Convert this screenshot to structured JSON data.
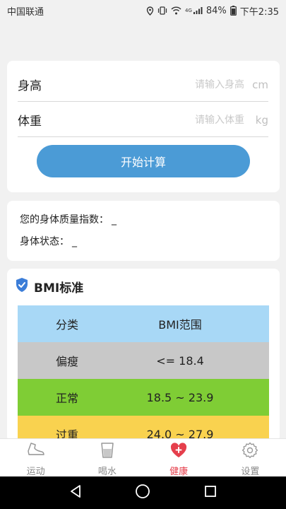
{
  "status_bar": {
    "carrier": "中国联通",
    "network": "4G",
    "battery": "84%",
    "time": "下午2:35"
  },
  "form": {
    "height_label": "身高",
    "height_placeholder": "请输入身高",
    "height_unit": "cm",
    "weight_label": "体重",
    "weight_placeholder": "请输入体重",
    "weight_unit": "kg",
    "calc_button": "开始计算"
  },
  "result": {
    "bmi_label": "您的身体质量指数：",
    "bmi_value": "_",
    "state_label": "身体状态：",
    "state_value": "_"
  },
  "bmi_standard": {
    "title": "BMI标准",
    "header": {
      "category": "分类",
      "range": "BMI范围",
      "color": "#a8d8f6"
    },
    "rows": [
      {
        "category": "偏瘦",
        "range": "<= 18.4",
        "color": "#c8c8c8"
      },
      {
        "category": "正常",
        "range": "18.5 ~ 23.9",
        "color": "#7fcd35"
      },
      {
        "category": "过重",
        "range": "24.0 ~ 27.9",
        "color": "#f9d24f"
      }
    ]
  },
  "bottom_nav": [
    {
      "label": "运动",
      "icon": "shoe-icon",
      "active": false
    },
    {
      "label": "喝水",
      "icon": "cup-icon",
      "active": false
    },
    {
      "label": "健康",
      "icon": "heart-plus-icon",
      "active": true
    },
    {
      "label": "设置",
      "icon": "gear-icon",
      "active": false
    }
  ],
  "colors": {
    "accent": "#4b9bd6",
    "active_tab": "#e53f4c",
    "shield": "#3b7dd8"
  }
}
